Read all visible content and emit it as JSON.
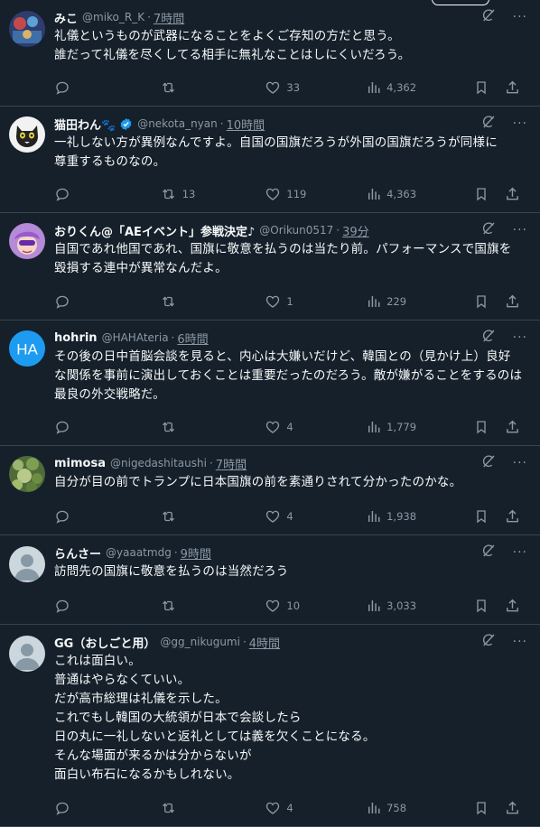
{
  "tweets": [
    {
      "name": "みこ",
      "handle": "@miko_R_K",
      "time": "7時間",
      "lines": "礼儀というものが武器になることをよくご存知の方だと思う。\n誰だって礼儀を尽くしてる相手に無礼なことはしにくいだろう。",
      "replies": "",
      "retweets": "",
      "likes": "33",
      "views": "4,362",
      "verified": false
    },
    {
      "name": "猫田わん🐾",
      "handle": "@nekota_nyan",
      "time": "10時間",
      "lines": "一礼しない方が異例なんですよ。自国の国旗だろうが外国の国旗だろうが同様に\n尊重するものなの。",
      "replies": "",
      "retweets": "13",
      "likes": "119",
      "views": "4,363",
      "verified": true
    },
    {
      "name": "おりくん@「AEイベント」参戦決定♪",
      "handle": "@Orikun0517",
      "time": "39分",
      "lines": "自国であれ他国であれ、国旗に敬意を払うのは当たり前。パフォーマンスで国旗を\n毀損する連中が異常なんだよ。",
      "replies": "",
      "retweets": "",
      "likes": "1",
      "views": "229",
      "verified": false
    },
    {
      "name": "hohrin",
      "handle": "@HAHAteria",
      "time": "6時間",
      "lines": "その後の日中首脳会談を見ると、内心は大嫌いだけど、韓国との（見かけ上）良好\nな関係を事前に演出しておくことは重要だったのだろう。敵が嫌がることをするのは\n最良の外交戦略だ。",
      "replies": "",
      "retweets": "",
      "likes": "4",
      "views": "1,779",
      "verified": false,
      "avatar_text": "HA"
    },
    {
      "name": "mimosa",
      "handle": "@nigedashitaushi",
      "time": "7時間",
      "lines": "自分が目の前でトランプに日本国旗の前を素通りされて分かったのかな。",
      "replies": "",
      "retweets": "",
      "likes": "4",
      "views": "1,938",
      "verified": false
    },
    {
      "name": "らんさー",
      "handle": "@yaaatmdg",
      "time": "9時間",
      "lines": "訪問先の国旗に敬意を払うのは当然だろう",
      "replies": "",
      "retweets": "",
      "likes": "10",
      "views": "3,033",
      "verified": false
    },
    {
      "name": "GG（おしごと用）",
      "handle": "@gg_nikugumi",
      "time": "4時間",
      "lines": "これは面白い。\n普通はやらなくていい。\nだが高市総理は礼儀を示した。\nこれでもし韓国の大統領が日本で会談したら\n日の丸に一礼しないと返礼としては義を欠くことになる。\nそんな場面が来るかは分からないが\n面白い布石になるかもしれない。",
      "replies": "",
      "retweets": "",
      "likes": "4",
      "views": "758",
      "verified": false
    }
  ],
  "colors": {
    "background": "#15202b",
    "divider": "#38444d",
    "muted": "#8b98a5",
    "verified": "#1d9bf0",
    "hohrin_avatar": "#1d9bf0"
  },
  "icons": [
    "reply-icon",
    "retweet-icon",
    "like-icon",
    "views-icon",
    "bookmark-icon",
    "share-icon",
    "grok-icon",
    "more-icon",
    "verified-icon"
  ]
}
